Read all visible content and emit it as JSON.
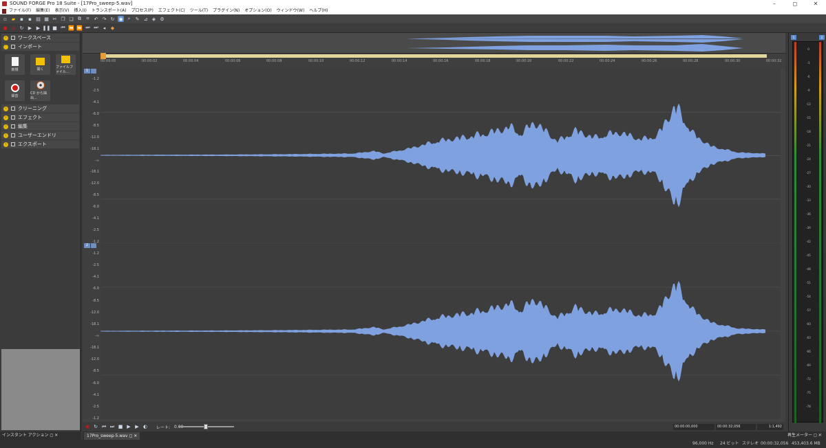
{
  "window": {
    "title": "SOUND FORGE Pro 18 Suite - [17Pro_sweep-5.wav]",
    "minimize": "–",
    "maximize": "◻",
    "close": "✕"
  },
  "menu": [
    "ファイル(F)",
    "編集(E)",
    "表示(V)",
    "挿入(I)",
    "トランスポート(A)",
    "プロセス(P)",
    "エフェクト(C)",
    "ツール(T)",
    "プラグイン(N)",
    "オプション(O)",
    "ウィンドウ(W)",
    "ヘルプ(H)"
  ],
  "left_panel": {
    "workspace": "ワークスペース",
    "import": "インポート",
    "tiles": [
      "新規",
      "開く",
      "ファイルファイル...",
      "録音",
      "CD から抽出..."
    ],
    "sections": [
      "クリーニング",
      "エフェクト",
      "編集",
      "ユーザーエンドリ",
      "エクスポート"
    ],
    "footer": "インスタント アクション"
  },
  "ruler": {
    "ticks": [
      "00:00:00",
      "00:00:02",
      "00:00:04",
      "00:00:06",
      "00:00:08",
      "00:00:10",
      "00:00:12",
      "00:00:14",
      "00:00:16",
      "00:00:18",
      "00:00:20",
      "00:00:22",
      "00:00:24",
      "00:00:26",
      "00:00:28",
      "00:00:30",
      "00:00:32"
    ]
  },
  "channels": [
    {
      "num": "1",
      "scale": [
        "-1.2",
        "-2.5",
        "-4.1",
        "-6.0",
        "-8.5",
        "-12.0",
        "-18.1",
        "-∞",
        "-18.1",
        "-12.0",
        "-8.5",
        "-6.0",
        "-4.1",
        "-2.5",
        "-1.2"
      ]
    },
    {
      "num": "2",
      "scale": [
        "-1.2",
        "-2.5",
        "-4.1",
        "-6.0",
        "-8.5",
        "-12.0",
        "-18.1",
        "-∞",
        "-18.1",
        "-12.0",
        "-8.5",
        "-6.0",
        "-4.1",
        "-2.5",
        "-1.2"
      ]
    }
  ],
  "transport": {
    "rate_label": "レート:",
    "rate_value": "0.00",
    "time_start": "00:00:00,000",
    "time_end": "00:00:32,056",
    "zoom": "1:1,492"
  },
  "tab": {
    "file": "17Pro_sweep-5.wav"
  },
  "meter": {
    "footer": "再生メーター",
    "ch1": "1",
    "ch2": "2",
    "labels": [
      "0",
      "-3",
      "-6",
      "-9",
      "-12",
      "-15",
      "-18",
      "-21",
      "-24",
      "-27",
      "-30",
      "-33",
      "-36",
      "-39",
      "-42",
      "-45",
      "-48",
      "-51",
      "-54",
      "-57",
      "-60",
      "-63",
      "-66",
      "-69",
      "-72",
      "-75",
      "-78"
    ]
  },
  "status": {
    "rate": "96,000 Hz",
    "bits": "24 ビット",
    "channels": "ステレオ",
    "duration": "00:00:32,056",
    "size": "453,403.6 MB"
  },
  "colors": {
    "wave": "#7fa1e0",
    "ruler_highlight": "#e2d59a",
    "accent": "#5a8ccf"
  }
}
